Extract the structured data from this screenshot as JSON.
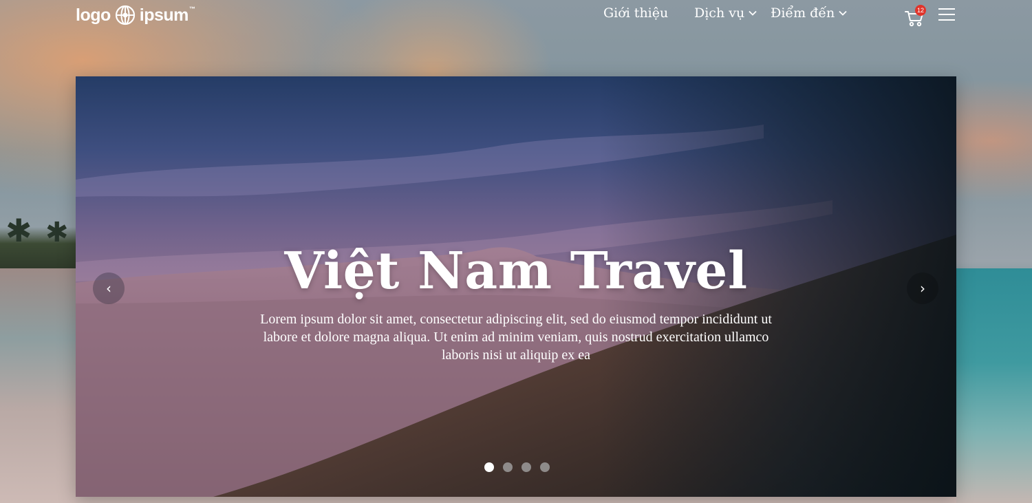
{
  "header": {
    "logo_left": "logo",
    "logo_right": "ipsum",
    "logo_tm": "™",
    "nav": [
      {
        "label": "Giới thiệu",
        "has_dropdown": false
      },
      {
        "label": "Dịch vụ",
        "has_dropdown": true
      },
      {
        "label": "Điểm đến",
        "has_dropdown": true
      }
    ],
    "cart_count": "12",
    "cart_icon": "cart-icon",
    "menu_icon": "hamburger-menu-icon"
  },
  "hero": {
    "title": "Việt Nam Travel",
    "description": "Lorem ipsum dolor sit amet, consectetur adipiscing elit, sed do eiusmod tempor incididunt ut labore et dolore magna aliqua. Ut enim ad minim veniam, quis nostrud exercitation ullamco laboris nisi ut aliquip ex ea",
    "prev_label": "‹",
    "next_label": "›",
    "slides_total": 4,
    "active_slide": 1
  },
  "colors": {
    "badge": "#e0342b",
    "text": "#ffffff"
  }
}
